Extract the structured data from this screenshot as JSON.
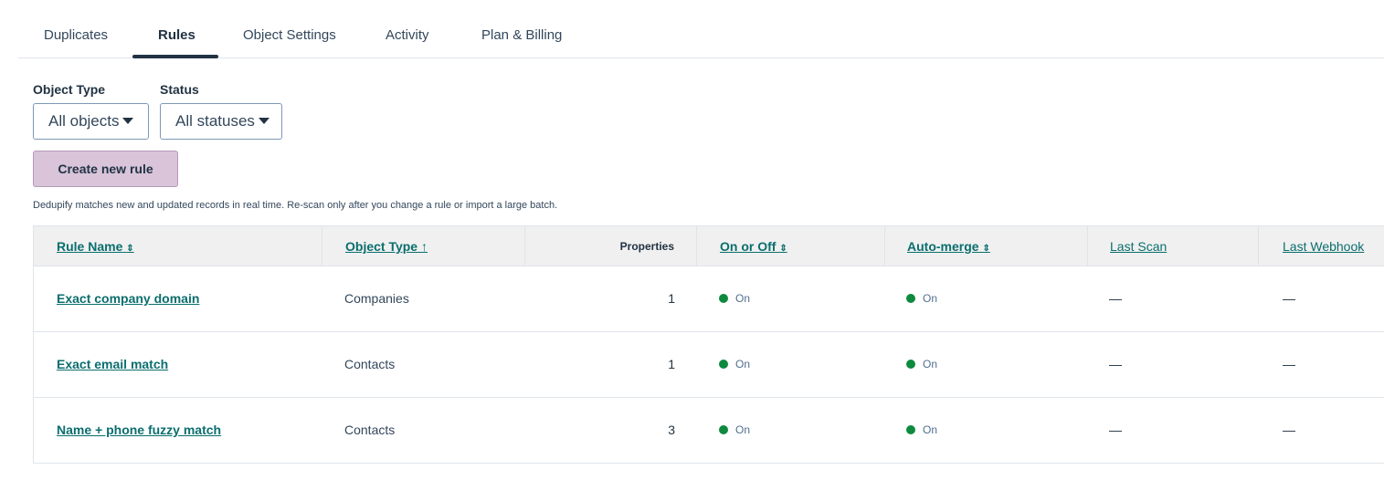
{
  "tabs": [
    {
      "label": "Duplicates"
    },
    {
      "label": "Rules"
    },
    {
      "label": "Object Settings"
    },
    {
      "label": "Activity"
    },
    {
      "label": "Plan & Billing"
    }
  ],
  "active_tab": "Rules",
  "filters": {
    "object_type_label": "Object Type",
    "object_type_value": "All objects",
    "status_label": "Status",
    "status_value": "All statuses"
  },
  "create_button": "Create new rule",
  "help_text": "Dedupify matches new and updated records in real time. Re-scan only after you change a rule or import a large batch.",
  "table": {
    "headers": {
      "rule_name": "Rule Name",
      "rule_name_sort": "⇕",
      "object_type": "Object Type",
      "object_type_sort": "↑",
      "properties": "Properties",
      "on_off": "On or Off",
      "on_off_sort": "⇕",
      "auto_merge": "Auto-merge",
      "auto_merge_sort": "⇕",
      "last_scan": "Last Scan",
      "last_webhook": "Last Webhook"
    },
    "rows": [
      {
        "name": "Exact company domain",
        "object_type": "Companies",
        "properties": "1",
        "on_off": "On",
        "auto_merge": "On",
        "last_scan": "—",
        "last_webhook": "—"
      },
      {
        "name": "Exact email match",
        "object_type": "Contacts",
        "properties": "1",
        "on_off": "On",
        "auto_merge": "On",
        "last_scan": "—",
        "last_webhook": "—"
      },
      {
        "name": "Name + phone fuzzy match",
        "object_type": "Contacts",
        "properties": "3",
        "on_off": "On",
        "auto_merge": "On",
        "last_scan": "—",
        "last_webhook": "—"
      }
    ]
  },
  "colors": {
    "link": "#0b6e6e",
    "status_on": "#0e8a3e",
    "create_button_bg": "#d9c4da",
    "header_bg": "#f0f0f0"
  }
}
